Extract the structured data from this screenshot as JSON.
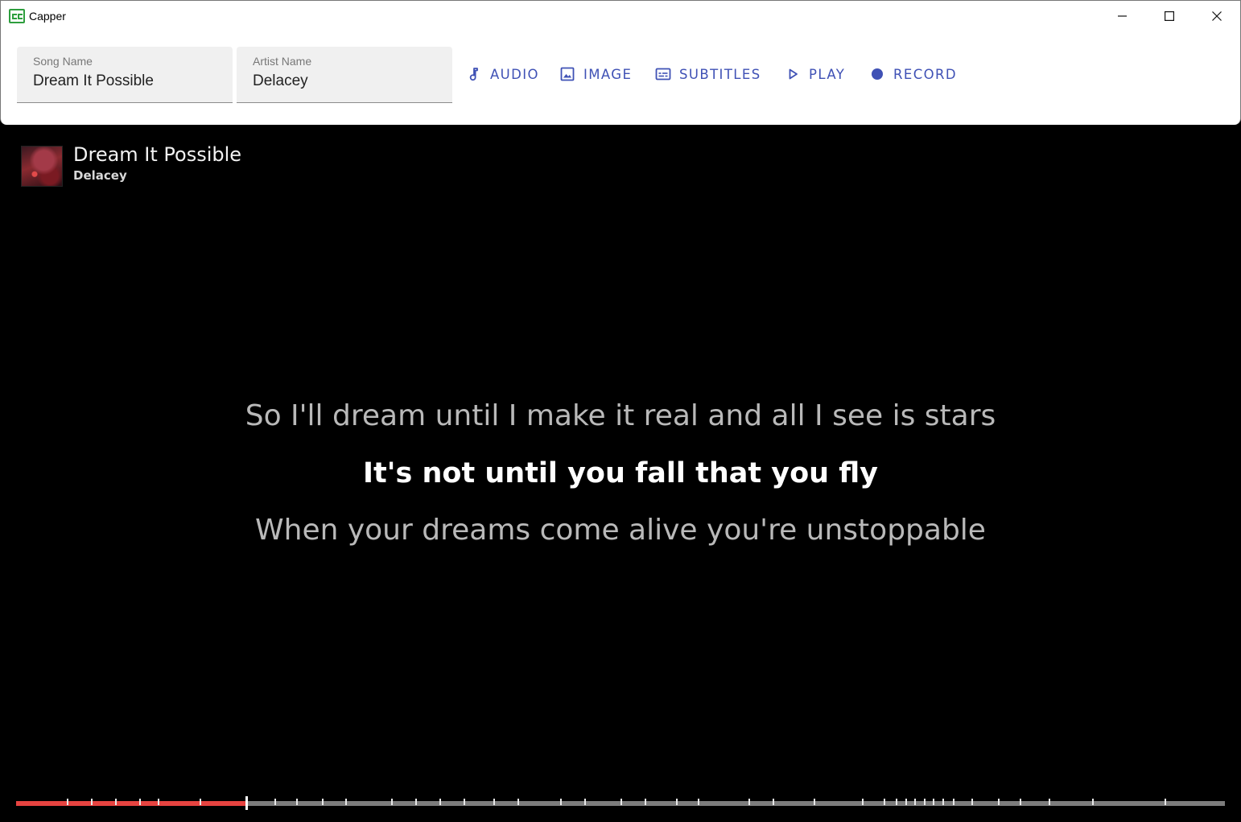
{
  "window": {
    "title": "Capper",
    "app_icon": "closed-captions-icon",
    "controls": [
      "minimize-icon",
      "maximize-icon",
      "close-icon"
    ]
  },
  "toolbar": {
    "song_field": {
      "label": "Song Name",
      "value": "Dream It Possible"
    },
    "artist_field": {
      "label": "Artist Name",
      "value": "Delacey"
    },
    "buttons": [
      {
        "label": "AUDIO",
        "icon": "music-note-icon"
      },
      {
        "label": "IMAGE",
        "icon": "image-icon"
      },
      {
        "label": "SUBTITLES",
        "icon": "subtitles-icon"
      },
      {
        "label": "PLAY",
        "icon": "play-icon"
      },
      {
        "label": "RECORD",
        "icon": "record-icon"
      }
    ],
    "accent_color": "#3f51b5"
  },
  "player": {
    "title": "Dream It Possible",
    "artist": "Delacey",
    "lyrics": {
      "previous": "So I'll dream until I make it real and all I see is stars",
      "current": "It's not until you fall that you fly",
      "next": "When your dreams come alive you're unstoppable"
    },
    "progress": {
      "fraction": 0.19,
      "fill_color": "#e64340",
      "track_color": "#7c7c7c",
      "markers": [
        0.042,
        0.062,
        0.082,
        0.102,
        0.117,
        0.152,
        0.19,
        0.214,
        0.232,
        0.253,
        0.272,
        0.31,
        0.33,
        0.35,
        0.37,
        0.395,
        0.415,
        0.45,
        0.47,
        0.5,
        0.52,
        0.546,
        0.564,
        0.606,
        0.626,
        0.66,
        0.7,
        0.718,
        0.728,
        0.736,
        0.743,
        0.751,
        0.758,
        0.766,
        0.775,
        0.79,
        0.812,
        0.83,
        0.854,
        0.89,
        0.95
      ]
    }
  }
}
